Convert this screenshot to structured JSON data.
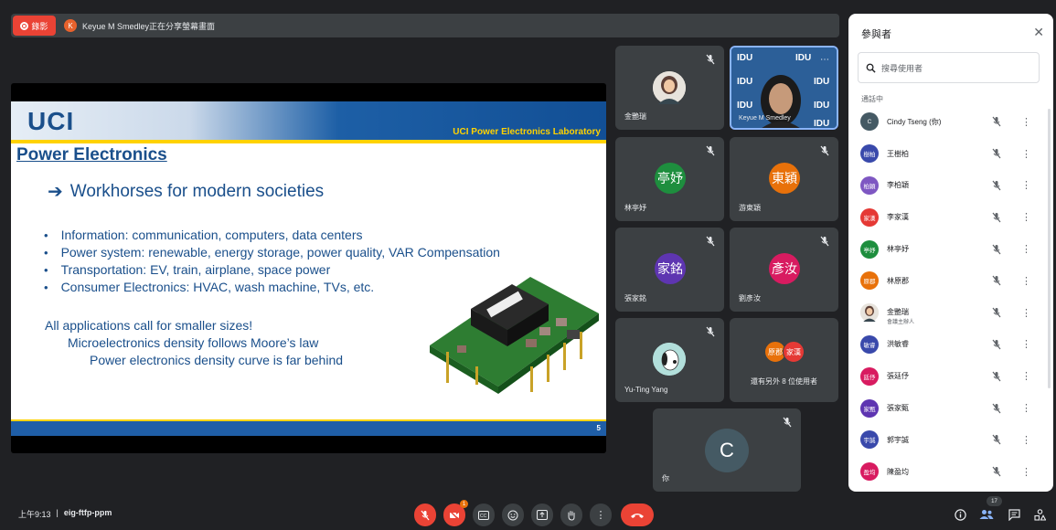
{
  "top_banner": {
    "record_label": "錄影",
    "presenter_initial": "K",
    "share_text": "Keyue M Smedley正在分享螢幕畫面"
  },
  "slide": {
    "logo": "UCI",
    "lab": "UCI Power Electronics Laboratory",
    "title": "Power Electronics",
    "subtitle": "Workhorses for modern societies",
    "bullets": [
      "Information: communication, computers, data centers",
      "Power system: renewable, energy storage, power quality, VAR Compensation",
      "Transportation: EV, train, airplane, space power",
      "Consumer Electronics: HVAC, wash machine, TVs, etc."
    ],
    "apps_line1": "All applications call for smaller sizes!",
    "apps_line2": "Microelectronics density follows Moore’s law",
    "apps_line3": "Power electronics density curve is far behind",
    "page_number": "5"
  },
  "tiles": {
    "t1_name": "金艷瑞",
    "t2_name": "Keyue M Smedley",
    "t3_name": "林亭妤",
    "t3_avatar": "亭妤",
    "t3_color": "#1e8e3e",
    "t4_name": "游東穎",
    "t4_avatar": "東穎",
    "t4_color": "#e8710a",
    "t5_name": "張家銘",
    "t5_avatar": "家銘",
    "t5_color": "#5e35b1",
    "t6_name": "劉彥汝",
    "t6_avatar": "彥汝",
    "t6_color": "#d81b60",
    "t7_name": "Yu-Ting Yang",
    "t8_label": "還有另外 8 位使用者",
    "t8_a1": "原郡",
    "t8_a2": "家漢",
    "t9_name": "你",
    "t9_avatar": "C"
  },
  "panel": {
    "title": "參與者",
    "search_placeholder": "搜尋使用者",
    "section": "通話中",
    "participants": [
      {
        "avatar": "C",
        "name": "Cindy Tseng (你)",
        "color": "#455a64"
      },
      {
        "avatar": "樹柏",
        "name": "王樹柏",
        "color": "#3949ab"
      },
      {
        "avatar": "柏穎",
        "name": "李柏穎",
        "color": "#7e57c2"
      },
      {
        "avatar": "家漢",
        "name": "李家漢",
        "color": "#e53935"
      },
      {
        "avatar": "亭妤",
        "name": "林亭妤",
        "color": "#1e8e3e"
      },
      {
        "avatar": "原郡",
        "name": "林原郡",
        "color": "#e8710a"
      },
      {
        "avatar": "",
        "name": "金艷瑞",
        "role": "會議主辦人",
        "color": "#e7e3dc"
      },
      {
        "avatar": "敏睿",
        "name": "洪敏睿",
        "color": "#3949ab"
      },
      {
        "avatar": "廷伃",
        "name": "張廷伃",
        "color": "#d81b60"
      },
      {
        "avatar": "家甄",
        "name": "張家甄",
        "color": "#5e35b1"
      },
      {
        "avatar": "宇誠",
        "name": "郭宇誠",
        "color": "#3949ab"
      },
      {
        "avatar": "盈均",
        "name": "陳盈均",
        "color": "#d81b60"
      }
    ]
  },
  "bottom": {
    "time": "上午9:13",
    "meeting_code": "eig-ftfp-ppm",
    "people_count": "17",
    "notif_count": "1"
  }
}
